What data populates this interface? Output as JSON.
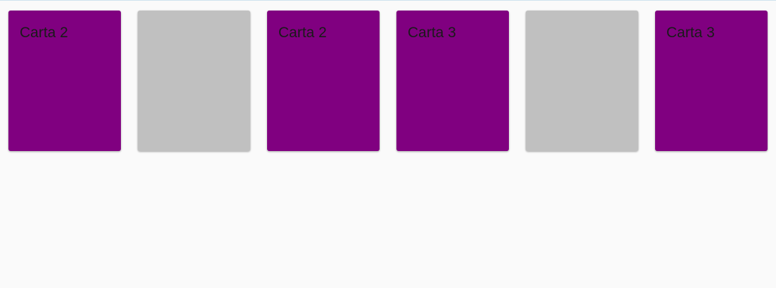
{
  "colors": {
    "background": "#fafafa",
    "card_face_up": "#800080",
    "card_face_down": "#c0c0c0",
    "card_text": "#1a1a1a"
  },
  "cards": [
    {
      "state": "face-up",
      "label": "Carta 2"
    },
    {
      "state": "face-down",
      "label": ""
    },
    {
      "state": "face-up",
      "label": "Carta 2"
    },
    {
      "state": "face-up",
      "label": "Carta 3"
    },
    {
      "state": "face-down",
      "label": ""
    },
    {
      "state": "face-up",
      "label": "Carta 3"
    }
  ]
}
